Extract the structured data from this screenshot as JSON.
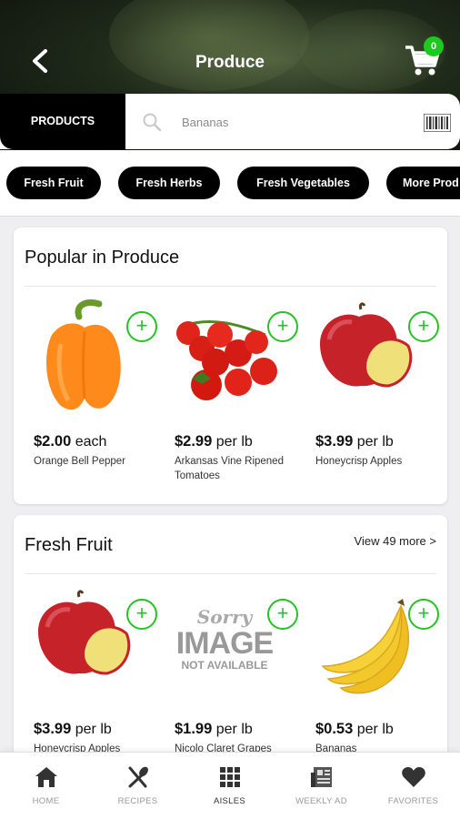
{
  "header": {
    "title": "Produce",
    "cart_count": "0"
  },
  "search": {
    "tab_label": "PRODUCTS",
    "value": "Bananas"
  },
  "categories": [
    "Fresh Fruit",
    "Fresh Herbs",
    "Fresh Vegetables",
    "More Prod"
  ],
  "popular": {
    "title": "Popular in Produce",
    "items": [
      {
        "price": "$2.00",
        "unit": "each",
        "name": "Orange Bell Pepper"
      },
      {
        "price": "$2.99",
        "unit": "per lb",
        "name": "Arkansas Vine Ripened Tomatoes"
      },
      {
        "price": "$3.99",
        "unit": "per lb",
        "name": "Honeycrisp Apples"
      }
    ]
  },
  "fresh_fruit": {
    "title": "Fresh Fruit",
    "view_more": "View 49 more >",
    "items": [
      {
        "price": "$3.99",
        "unit": "per lb",
        "name": "Honeycrisp Apples"
      },
      {
        "price": "$1.99",
        "unit": "per lb",
        "name": "Nicolo Claret Grapes",
        "placeholder": {
          "line1": "Sorry",
          "line2": "IMAGE",
          "line3": "NOT AVAILABLE"
        }
      },
      {
        "price": "$0.53",
        "unit": "per lb",
        "name": "Bananas"
      }
    ]
  },
  "nav": [
    {
      "label": "HOME",
      "icon": "home-icon"
    },
    {
      "label": "RECIPES",
      "icon": "utensils-icon"
    },
    {
      "label": "AISLES",
      "icon": "grid-icon"
    },
    {
      "label": "WEEKLY AD",
      "icon": "newspaper-icon"
    },
    {
      "label": "FAVORITES",
      "icon": "heart-icon"
    }
  ],
  "colors": {
    "accent_green": "#22c322",
    "badge_green": "#1ec91e"
  }
}
